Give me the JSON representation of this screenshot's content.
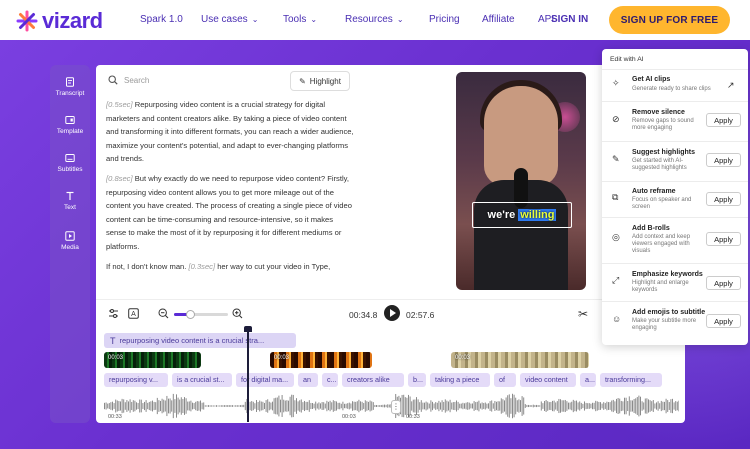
{
  "nav": {
    "logo_text": "vizard",
    "items": [
      "Spark 1.0",
      "Use cases",
      "Tools",
      "Resources",
      "Pricing",
      "Affiliate",
      "API"
    ],
    "signin": "SIGN IN",
    "signup": "SIGN UP FOR FREE"
  },
  "rail": {
    "items": [
      {
        "label": "Transcript",
        "icon": "transcript-icon"
      },
      {
        "label": "Template",
        "icon": "template-icon"
      },
      {
        "label": "Subtitles",
        "icon": "subtitles-icon"
      },
      {
        "label": "Text",
        "icon": "text-icon"
      },
      {
        "label": "Media",
        "icon": "media-icon"
      }
    ]
  },
  "editor": {
    "search_placeholder": "Search",
    "highlight_label": "Highlight",
    "paragraphs": [
      {
        "ts": "[0.5sec]",
        "text": " Repurposing video content is a crucial strategy for digital marketers and content creators alike. By taking a piece of video content and transforming it into different formats, you can reach a wider audience, maximize your content's potential, and adapt to ever-changing platforms and trends."
      },
      {
        "ts": "[0.8sec]",
        "text": " But why exactly do we need to repurpose video content? Firstly, repurposing video content allows you to get more mileage out of the content you have created. The process of creating a single piece of video content can be time-consuming and resource-intensive, so it makes sense to make the most of it by repurposing it for different mediums or platforms."
      },
      {
        "pre": "If not, I don't know man. ",
        "ts": "[0.3sec]",
        "text": " her way to cut your video in Type,"
      }
    ],
    "caption_word": "we're",
    "caption_highlight": "willing"
  },
  "timeline": {
    "current_time": "00:34.8",
    "total_time": "02:57.6",
    "zoom_level": 0.3,
    "text_clip": "repurposing video content is a crucial stra...",
    "clip_labels": [
      "00:03",
      "00:03",
      "00:03"
    ],
    "words": [
      "repurposing v...",
      "is a crucial st...",
      "for digital ma...",
      "an",
      "c...",
      "creators alike",
      "b...",
      "taking a piece",
      "of",
      "video content",
      "a...",
      "transforming..."
    ],
    "wave_labels": [
      "00:33",
      "00:03",
      "00:33"
    ]
  },
  "ai_panel": {
    "title": "Edit with AI",
    "items": [
      {
        "name": "Get AI clips",
        "desc": "Generate ready to share clips",
        "action": "open"
      },
      {
        "name": "Remove silence",
        "desc": "Remove gaps to sound more engaging",
        "action": "Apply"
      },
      {
        "name": "Suggest highlights",
        "desc": "Get started with AI-suggested highlights",
        "action": "Apply"
      },
      {
        "name": "Auto reframe",
        "desc": "Focus on speaker and screen",
        "action": "Apply"
      },
      {
        "name": "Add B-rolls",
        "desc": "Add context and keep viewers engaged with visuals",
        "action": "Apply"
      },
      {
        "name": "Emphasize keywords",
        "desc": "Highlight and enlarge keywords",
        "action": "Apply"
      },
      {
        "name": "Add emojis to subtitle",
        "desc": "Make your subtitle more engaging",
        "action": "Apply"
      }
    ]
  },
  "colors": {
    "brand": "#5a2bd6",
    "cta": "#ffb62e",
    "hero": "#6a30d0"
  }
}
